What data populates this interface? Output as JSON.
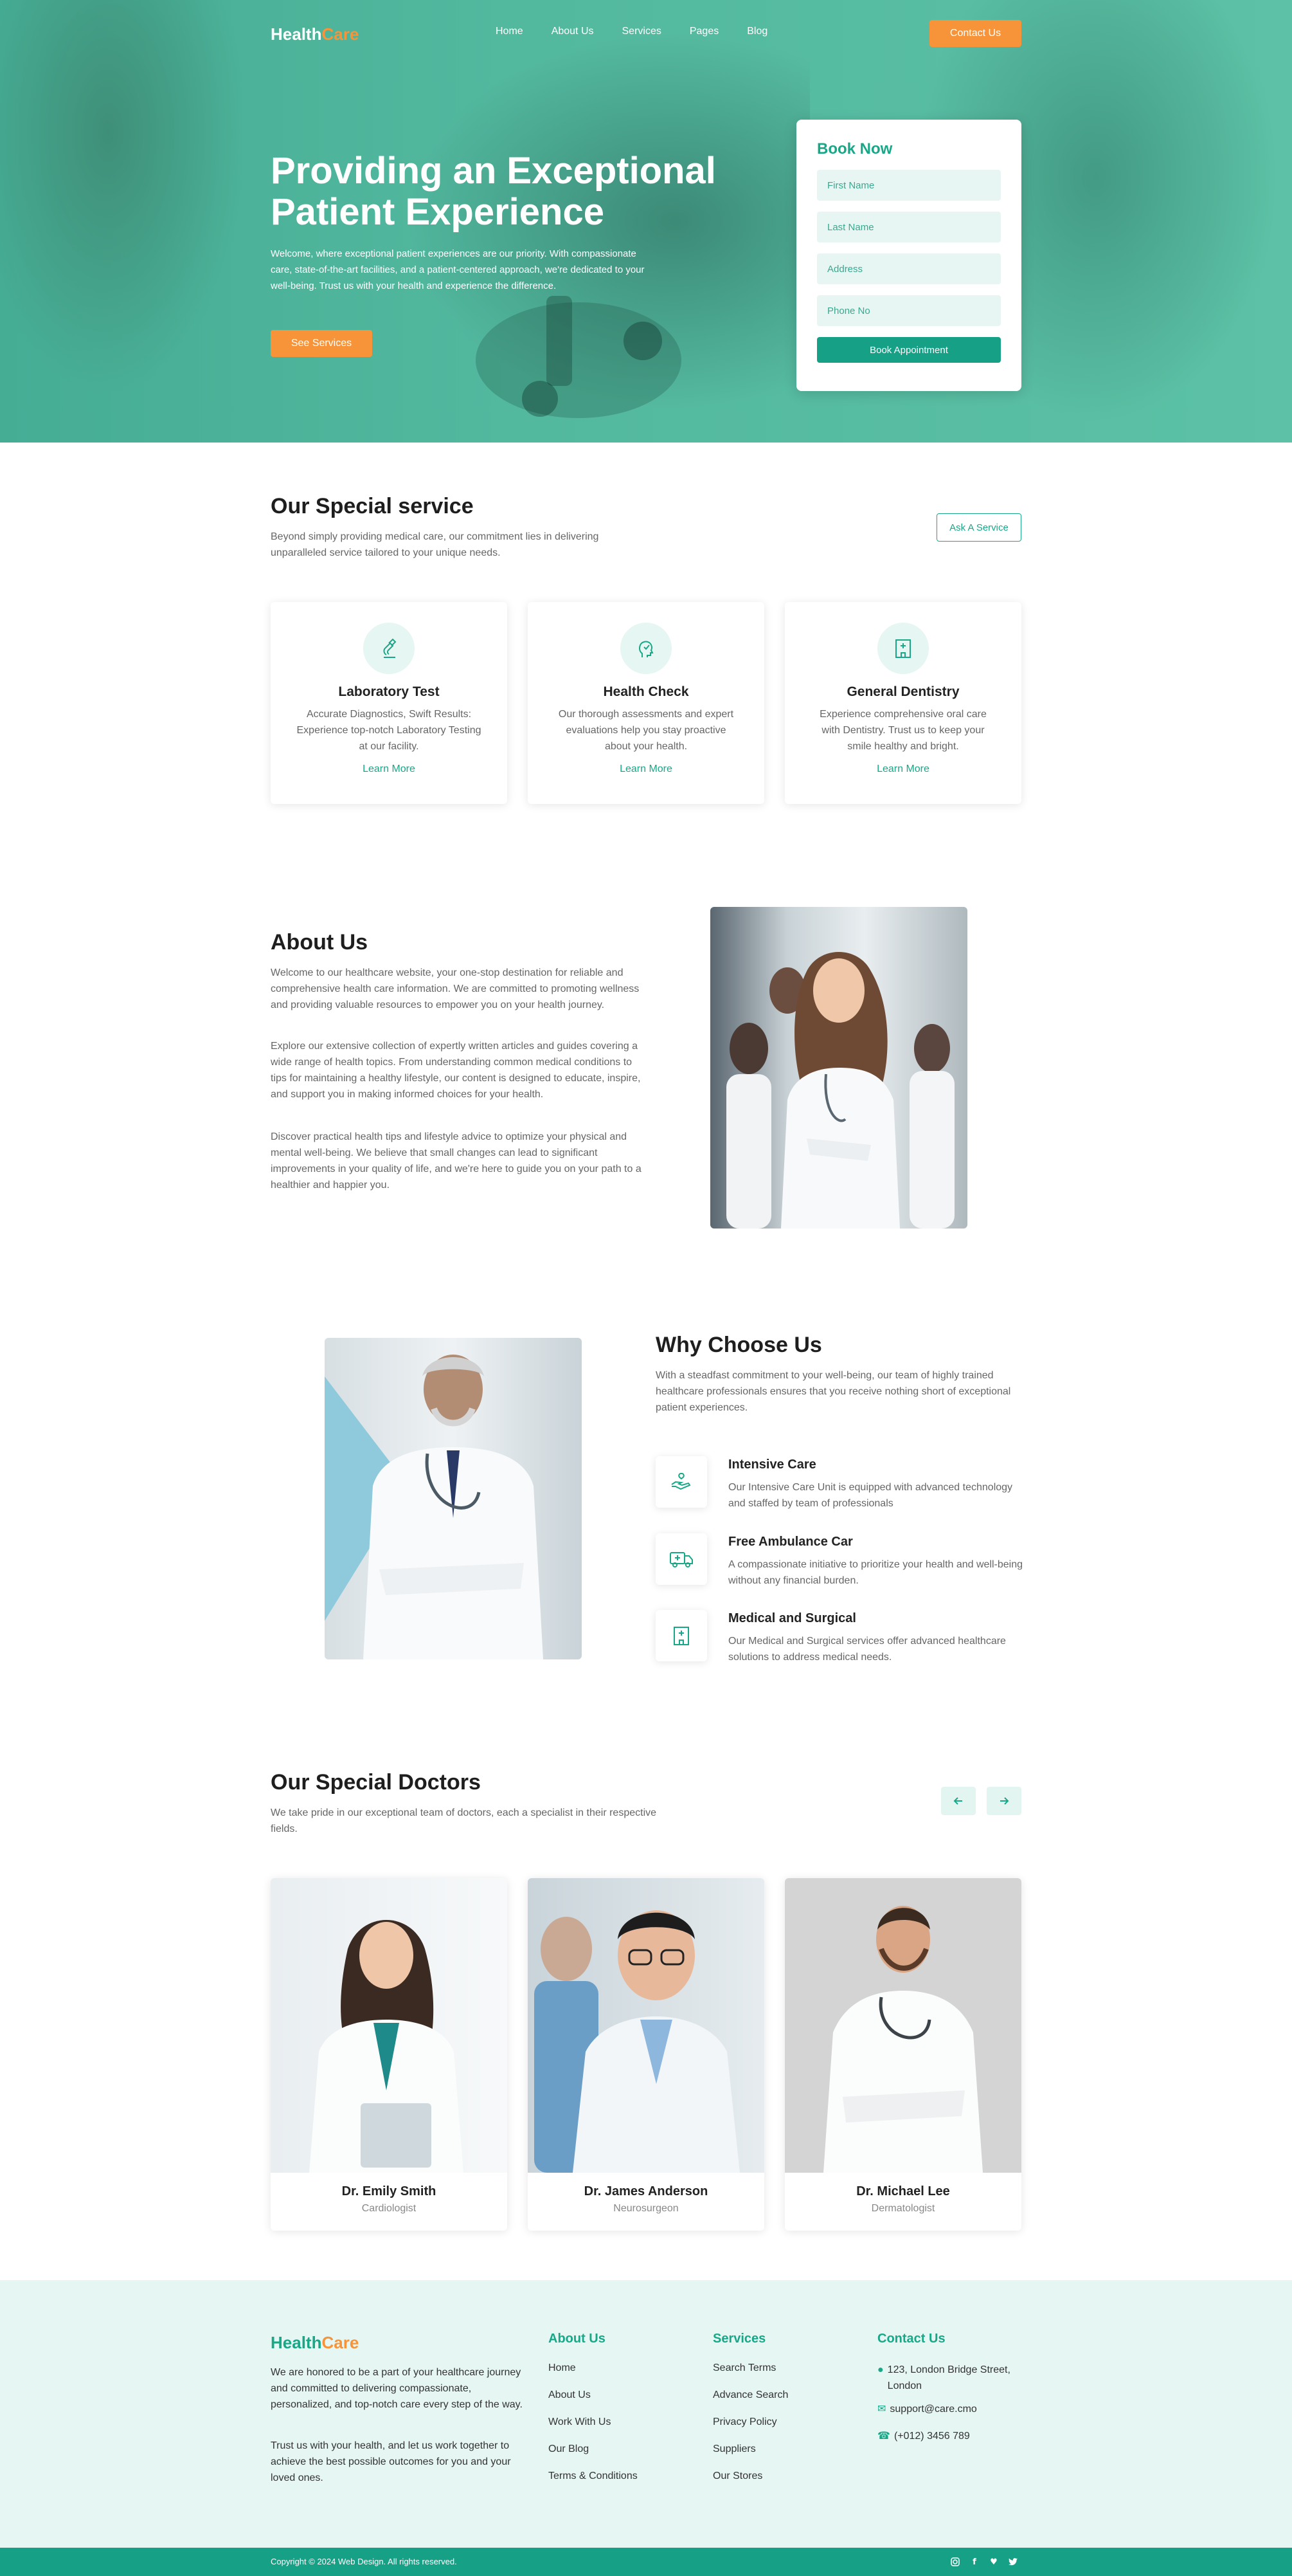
{
  "brand": {
    "part1": "Health",
    "part2": "Care"
  },
  "nav": {
    "items": [
      "Home",
      "About Us",
      "Services",
      "Pages",
      "Blog"
    ],
    "contact": "Contact Us"
  },
  "hero": {
    "title": "Providing an Exceptional Patient Experience",
    "text": "Welcome, where exceptional patient experiences are our priority. With compassionate care, state-of-the-art facilities, and a patient-centered approach, we're dedicated to your well-being. Trust us with your health and experience the difference.",
    "cta": "See Services"
  },
  "book": {
    "title": "Book Now",
    "fields": [
      "First Name",
      "Last Name",
      "Address",
      "Phone No"
    ],
    "submit": "Book Appointment"
  },
  "services": {
    "title": "Our Special service",
    "subtitle": "Beyond simply providing medical care, our commitment lies in delivering unparalleled service tailored to your unique needs.",
    "button": "Ask A Service",
    "cards": [
      {
        "title": "Laboratory Test",
        "text": "Accurate Diagnostics, Swift Results: Experience top-notch Laboratory Testing at our facility.",
        "link": "Learn More",
        "icon": "lab-icon"
      },
      {
        "title": "Health Check",
        "text": "Our thorough assessments and expert evaluations help you stay proactive about your health.",
        "link": "Learn More",
        "icon": "head-check-icon"
      },
      {
        "title": "General Dentistry",
        "text": "Experience comprehensive oral care with Dentistry. Trust us to keep your smile healthy and bright.",
        "link": "Learn More",
        "icon": "hospital-icon"
      }
    ]
  },
  "about": {
    "title": "About Us",
    "p1": "Welcome to our healthcare website, your one-stop destination for reliable and comprehensive health care information. We are committed to promoting wellness and providing valuable resources to empower you on your health journey.",
    "p2": "Explore our extensive collection of expertly written articles and guides covering a wide range of health topics. From understanding common medical conditions to tips for maintaining a healthy lifestyle, our content is designed to educate, inspire, and support you in making informed choices for your health.",
    "p3": "Discover practical health tips and lifestyle advice to optimize your physical and mental well-being. We believe that small changes can lead to significant improvements in your quality of life, and we're here to guide you on your path to a healthier and happier you."
  },
  "why": {
    "title": "Why Choose Us",
    "text": "With a steadfast commitment to your well-being, our team of highly trained healthcare professionals ensures that you receive nothing short of exceptional patient experiences.",
    "features": [
      {
        "title": "Intensive Care",
        "text": "Our Intensive Care Unit is equipped with advanced technology and staffed by team of professionals",
        "icon": "care-hand-icon"
      },
      {
        "title": "Free Ambulance Car",
        "text": "A compassionate initiative to prioritize your health and well-being without any financial burden.",
        "icon": "ambulance-icon"
      },
      {
        "title": "Medical and Surgical",
        "text": "Our Medical and Surgical services offer advanced healthcare solutions to address medical needs.",
        "icon": "hospital-icon"
      }
    ]
  },
  "doctors": {
    "title": "Our Special Doctors",
    "subtitle": "We take pride in our exceptional team of doctors, each a specialist in their respective fields.",
    "list": [
      {
        "name": "Dr. Emily Smith",
        "role": "Cardiologist"
      },
      {
        "name": "Dr. James Anderson",
        "role": "Neurosurgeon"
      },
      {
        "name": "Dr. Michael Lee",
        "role": "Dermatologist"
      }
    ]
  },
  "footer": {
    "p1": "We are honored to be a part of your healthcare journey and committed to delivering compassionate, personalized, and top-notch care every step of the way.",
    "p2": "Trust us with your health, and let us work together to achieve the best possible outcomes for you and your loved ones.",
    "about": {
      "title": "About Us",
      "items": [
        "Home",
        "About Us",
        "Work With Us",
        "Our Blog",
        "Terms & Conditions"
      ]
    },
    "services": {
      "title": "Services",
      "items": [
        "Search Terms",
        "Advance Search",
        "Privacy Policy",
        "Suppliers",
        "Our Stores"
      ]
    },
    "contact": {
      "title": "Contact Us",
      "address": "123, London Bridge Street, London",
      "email": "support@care.cmo",
      "phone": "(+012) 3456 789"
    },
    "copyright": "Copyright © 2024 Web Design. All rights reserved."
  },
  "colors": {
    "primary": "#16a085",
    "accent": "#f7943a",
    "light": "#e6f6f3"
  }
}
